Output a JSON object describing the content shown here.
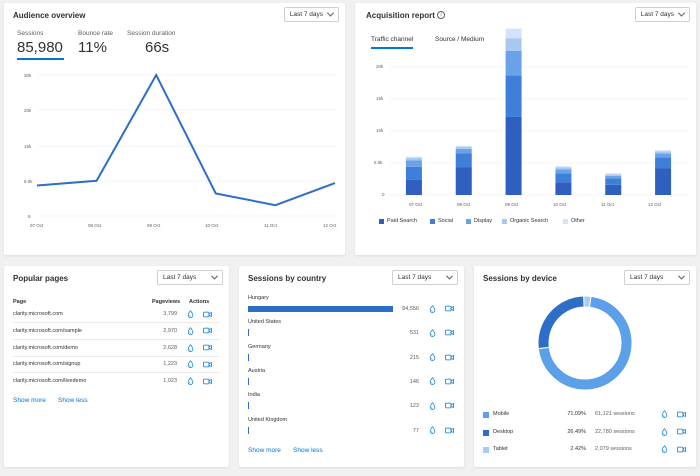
{
  "audience": {
    "title": "Audience overview",
    "dropdown": "Last 7 days",
    "metrics": [
      {
        "label": "Sessions",
        "value": "85,980"
      },
      {
        "label": "Bounce rate",
        "value": "11%"
      },
      {
        "label": "Session duration",
        "value": "66s"
      }
    ],
    "y_ticks": [
      "30k",
      "20k",
      "15k",
      "8.0k",
      "5"
    ],
    "x_ticks": [
      "07 Oct",
      "08 Oct",
      "09 Oct",
      "10 Oct",
      "11 Oct",
      "12 Oct"
    ]
  },
  "acquisition": {
    "title": "Acquisition report",
    "dropdown": "Last 7 days",
    "tabs": [
      "Traffic channel",
      "Source / Medium"
    ],
    "y_ticks": [
      "20k",
      "15k",
      "10k",
      "5.0k",
      "0"
    ],
    "x_ticks": [
      "07 Oct",
      "08 Oct",
      "09 Oct",
      "10 Oct",
      "11 Oct",
      "12 Oct"
    ],
    "legend": [
      "Paid Search",
      "Social",
      "Display",
      "Organic Search",
      "Other"
    ]
  },
  "popular": {
    "title": "Popular pages",
    "dropdown": "Last 7 days",
    "headers": {
      "page": "Page",
      "views": "Pageviews",
      "actions": "Actions"
    },
    "rows": [
      {
        "page": "clarity.microsoft.com",
        "views": "3,799"
      },
      {
        "page": "clarity.microsoft.com/sample",
        "views": "2,970"
      },
      {
        "page": "clarity.microsoft.com/demo",
        "views": "2,628"
      },
      {
        "page": "clarity.microsoft.com/signup",
        "views": "1,223"
      },
      {
        "page": "clarity.microsoft.com/livedemo",
        "views": "1,023"
      }
    ],
    "show_more": "Show more",
    "show_less": "Show less"
  },
  "country": {
    "title": "Sessions by country",
    "dropdown": "Last 7 days",
    "rows": [
      {
        "name": "Hungary",
        "value": "84,556",
        "fraction": 1.0
      },
      {
        "name": "United States",
        "value": "531",
        "fraction": 0.006
      },
      {
        "name": "Germany",
        "value": "215",
        "fraction": 0.003
      },
      {
        "name": "Austria",
        "value": "146",
        "fraction": 0.002
      },
      {
        "name": "India",
        "value": "123",
        "fraction": 0.001
      },
      {
        "name": "United Kingdom",
        "value": "77",
        "fraction": 0.001
      }
    ],
    "show_more": "Show more",
    "show_less": "Show less"
  },
  "device": {
    "title": "Sessions by device",
    "dropdown": "Last 7 days",
    "rows": [
      {
        "name": "Mobile",
        "pct": "71.09%",
        "sessions": "61,121 sessions",
        "color": "#5ba0e8"
      },
      {
        "name": "Desktop",
        "pct": "26.49%",
        "sessions": "22,780 sessions",
        "color": "#2f6ec8"
      },
      {
        "name": "Tablet",
        "pct": "2.42%",
        "sessions": "2,079 sessions",
        "color": "#a9cdf2"
      }
    ]
  },
  "chart_data": [
    {
      "type": "line",
      "categories": [
        "07 Oct",
        "08 Oct",
        "09 Oct",
        "10 Oct",
        "11 Oct",
        "12 Oct"
      ],
      "series": [
        {
          "values": [
            6500,
            7500,
            30000,
            4800,
            2300,
            7000
          ]
        }
      ],
      "ylim": [
        0,
        30000
      ],
      "color": "#2f6ec8"
    },
    {
      "type": "bar",
      "stacked": true,
      "categories": [
        "07 Oct",
        "08 Oct",
        "09 Oct",
        "10 Oct",
        "11 Oct",
        "12 Oct"
      ],
      "series": [
        {
          "name": "Paid Search",
          "values": [
            2400,
            4300,
            12200,
            2000,
            1600,
            4200
          ],
          "color": "#2f5fbf"
        },
        {
          "name": "Social",
          "values": [
            2000,
            2200,
            6500,
            1400,
            1000,
            1700
          ],
          "color": "#3d7fd9"
        },
        {
          "name": "Display",
          "values": [
            1000,
            700,
            3800,
            600,
            400,
            600
          ],
          "color": "#6aa2ea"
        },
        {
          "name": "Organic Search",
          "values": [
            400,
            300,
            2000,
            300,
            200,
            300
          ],
          "color": "#a8c8f2"
        },
        {
          "name": "Other",
          "values": [
            200,
            200,
            1500,
            200,
            200,
            200
          ],
          "color": "#d3e3f8"
        }
      ],
      "ylim": [
        0,
        20000
      ],
      "legend": "bottom"
    },
    {
      "type": "pie",
      "categories": [
        "Mobile",
        "Desktop",
        "Tablet"
      ],
      "values": [
        71.09,
        26.49,
        2.42
      ]
    }
  ]
}
